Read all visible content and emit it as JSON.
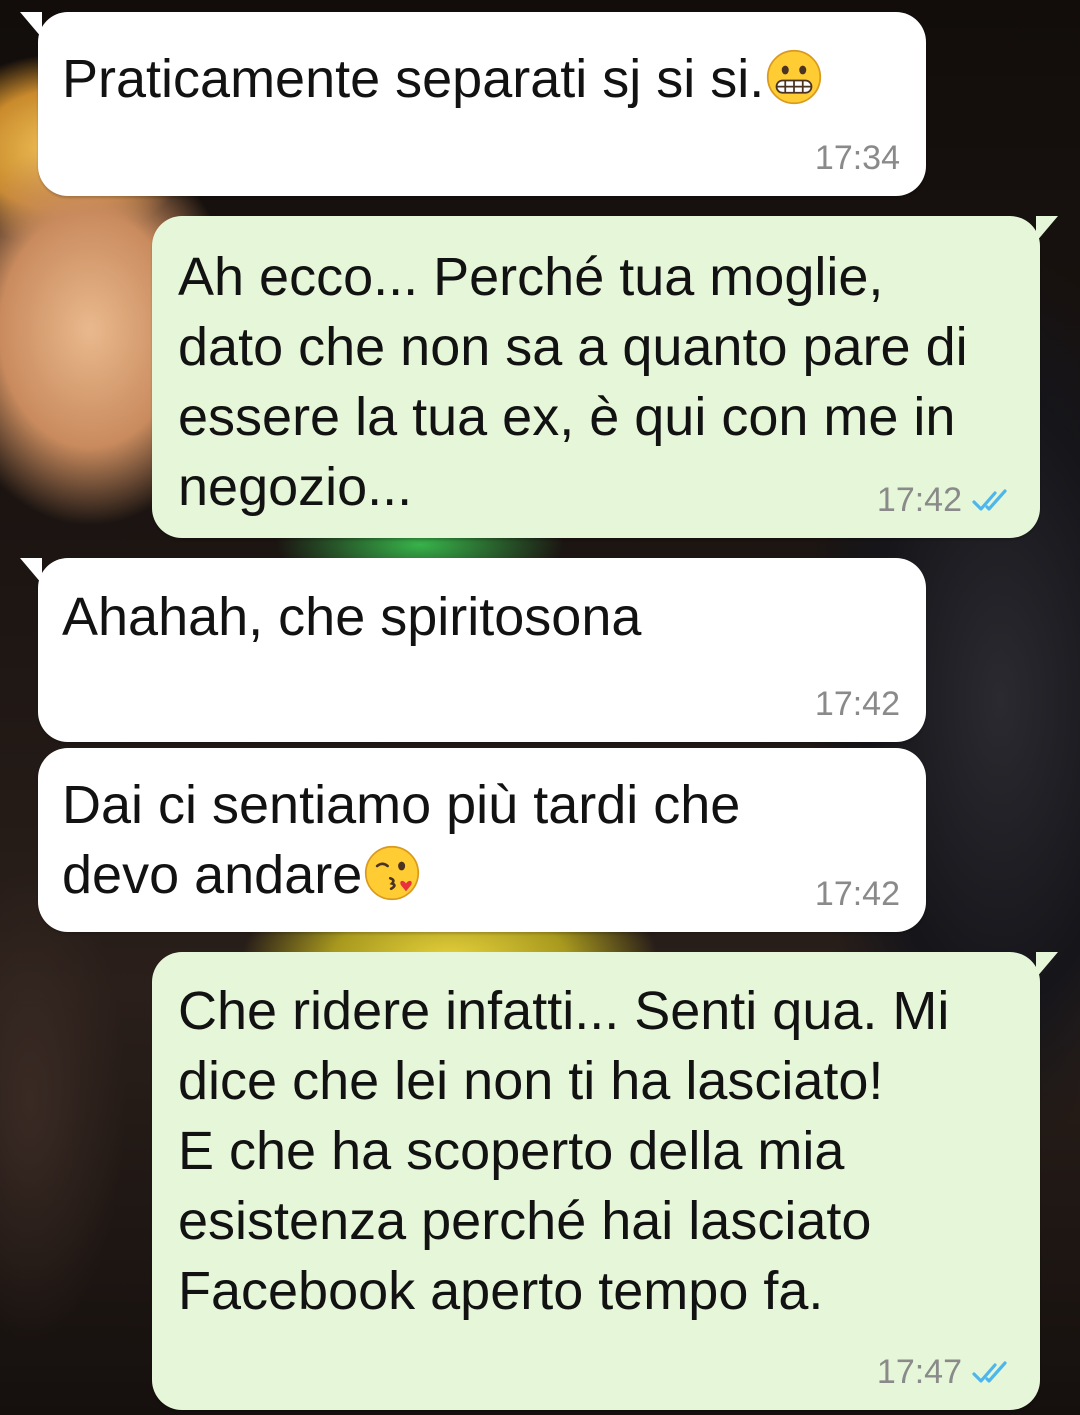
{
  "colors": {
    "incoming_bubble": "#ffffff",
    "outgoing_bubble": "#e6f7d9",
    "timestamp": "#8a8a8a",
    "read_ticks": "#4fb6ec"
  },
  "messages": [
    {
      "direction": "incoming",
      "text": "Praticamente separati sj si si.",
      "emoji": "grimacing-face-emoji",
      "time": "17:34"
    },
    {
      "direction": "outgoing",
      "text": "Ah ecco... Perché tua moglie,\ndato che non sa a quanto pare di\nessere la tua ex, è qui con me in\nnegozio...",
      "time": "17:42",
      "status_icon": "double-check-read-icon"
    },
    {
      "direction": "incoming",
      "text": "Ahahah, che spiritosona",
      "time": "17:42"
    },
    {
      "direction": "incoming",
      "text": "Dai ci sentiamo più tardi che\ndevo andare",
      "emoji": "face-blowing-a-kiss-emoji",
      "time": "17:42"
    },
    {
      "direction": "outgoing",
      "text": "Che ridere infatti... Senti qua. Mi\ndice che lei non ti ha lasciato!\nE che ha scoperto della mia\nesistenza perché hai lasciato\nFacebook aperto tempo fa.",
      "time": "17:47",
      "status_icon": "double-check-read-icon"
    }
  ]
}
